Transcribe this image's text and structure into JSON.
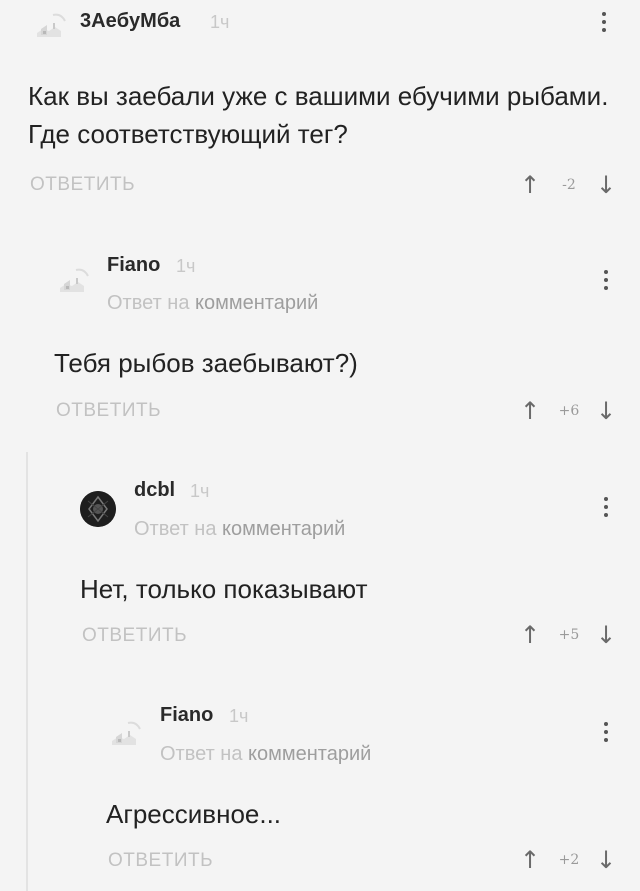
{
  "comments": [
    {
      "username": "3AeбyMбa",
      "time": "1ч",
      "reply_to_prefix": "",
      "reply_to_link": "",
      "text": "Как вы заебали уже с вашими ебучими рыбами. Где соответствующий тег?",
      "reply_label": "ОТВЕТИТЬ",
      "rating": "-2",
      "avatar_icon": "default-avatar-icon"
    },
    {
      "username": "Fiano",
      "time": "1ч",
      "reply_to_prefix": "Ответ на",
      "reply_to_link": "комментарий",
      "text": "Тебя рыбов заебывают?)",
      "reply_label": "ОТВЕТИТЬ",
      "rating": "+6",
      "avatar_icon": "default-avatar-icon"
    },
    {
      "username": "dcbl",
      "time": "1ч",
      "reply_to_prefix": "Ответ на",
      "reply_to_link": "комментарий",
      "text": "Нет, только показывают",
      "reply_label": "ОТВЕТИТЬ",
      "rating": "+5",
      "avatar_icon": "user-photo-avatar"
    },
    {
      "username": "Fiano",
      "time": "1ч",
      "reply_to_prefix": "Ответ на",
      "reply_to_link": "комментарий",
      "text": "Агрессивное...",
      "reply_label": "ОТВЕТИТЬ",
      "rating": "+2",
      "avatar_icon": "default-avatar-icon"
    }
  ],
  "icons": {
    "upvote": "arrow-up-icon",
    "downvote": "arrow-down-icon",
    "more": "more-vertical-icon"
  },
  "colors": {
    "background": "#f4f4f4",
    "text": "#222222",
    "muted": "#c2c2c2",
    "username": "#2a2a2a"
  }
}
